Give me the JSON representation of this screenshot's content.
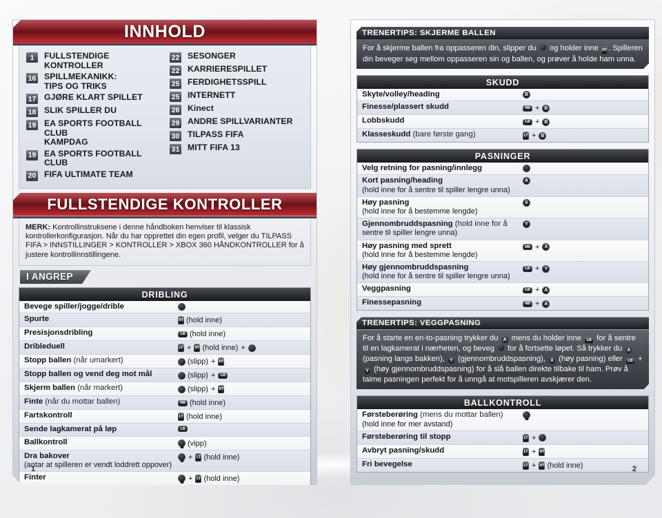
{
  "pages": {
    "left_number": "1",
    "right_number": "2"
  },
  "left": {
    "contents_banner": "INNHOLD",
    "toc": {
      "col1": [
        {
          "page": "1",
          "label": "FULLSTENDIGE KONTROLLER"
        },
        {
          "page": "16",
          "label": "SPILLMEKANIKK:\nTIPS OG TRIKS"
        },
        {
          "page": "17",
          "label": "GJØRE KLART SPILLET"
        },
        {
          "page": "18",
          "label": "SLIK SPILLER DU"
        },
        {
          "page": "19",
          "label": "EA SPORTS FOOTBALL CLUB\nKAMPDAG"
        },
        {
          "page": "19",
          "label": "EA SPORTS FOOTBALL CLUB"
        },
        {
          "page": "20",
          "label": "FIFA ULTIMATE TEAM"
        }
      ],
      "col2": [
        {
          "page": "22",
          "label": "SESONGER"
        },
        {
          "page": "22",
          "label": "KARRIERESPILLET"
        },
        {
          "page": "25",
          "label": "FERDIGHETSSPILL"
        },
        {
          "page": "25",
          "label": "INTERNETT"
        },
        {
          "page": "26",
          "label": "Kinect"
        },
        {
          "page": "29",
          "label": "ANDRE SPILLVARIANTER"
        },
        {
          "page": "30",
          "label": "TILPASS FIFA"
        },
        {
          "page": "31",
          "label": "MITT FIFA 13"
        }
      ]
    },
    "controls_banner": "FULLSTENDIGE KONTROLLER",
    "note": {
      "label": "MERK:",
      "text": " Kontrollinstruksene i denne håndboken henviser til klassisk kontrollerkonfigurasjon. Når du har opprettet din egen profil, velger du TILPASS FIFA > INNSTILLINGER > KONTROLLER > XBOX 360 HÅNDKONTROLLER for å justere kontrollinnstillingene."
    },
    "tab": "I ANGREP",
    "dribling": {
      "header": "DRIBLING",
      "rows": [
        {
          "name": "Bevege spiller/jogge/drible",
          "sub": "",
          "line2": "",
          "combo": [
            {
              "t": "stick",
              "k": "LS"
            }
          ]
        },
        {
          "name": "Spurte",
          "sub": "",
          "line2": "",
          "combo": [
            {
              "t": "trig",
              "k": "RT"
            },
            {
              "t": "txt",
              "k": "(hold inne)"
            }
          ]
        },
        {
          "name": "Presisjonsdribling",
          "sub": "",
          "line2": "",
          "combo": [
            {
              "t": "bump",
              "k": "LB"
            },
            {
              "t": "txt",
              "k": "(hold inne)"
            }
          ]
        },
        {
          "name": "Dribleduell",
          "sub": "",
          "line2": "",
          "combo": [
            {
              "t": "trig",
              "k": "LT"
            },
            {
              "t": "plus",
              "k": "+"
            },
            {
              "t": "trig",
              "k": "RT"
            },
            {
              "t": "txt",
              "k": "(hold inne)"
            },
            {
              "t": "plus",
              "k": "+"
            },
            {
              "t": "stick",
              "k": "LS"
            }
          ]
        },
        {
          "name": "Stopp ballen",
          "sub": " (når umarkert)",
          "line2": "",
          "combo": [
            {
              "t": "stick",
              "k": "LS"
            },
            {
              "t": "txt",
              "k": "(slipp)"
            },
            {
              "t": "plus",
              "k": "+"
            },
            {
              "t": "trig",
              "k": "RT"
            }
          ]
        },
        {
          "name": "Stopp ballen og vend deg mot mål",
          "sub": "",
          "line2": "",
          "combo": [
            {
              "t": "stick",
              "k": "LS"
            },
            {
              "t": "txt",
              "k": "(slipp)"
            },
            {
              "t": "plus",
              "k": "+"
            },
            {
              "t": "bump",
              "k": "LB"
            }
          ]
        },
        {
          "name": "Skjerm ballen",
          "sub": " (når markert)",
          "line2": "",
          "combo": [
            {
              "t": "stick",
              "k": "LS"
            },
            {
              "t": "txt",
              "k": "(slipp)"
            },
            {
              "t": "plus",
              "k": "+"
            },
            {
              "t": "trig",
              "k": "RT"
            }
          ]
        },
        {
          "name": "Finte",
          "sub": " (når du mottar ballen)",
          "line2": "",
          "combo": [
            {
              "t": "bump",
              "k": "RB"
            },
            {
              "t": "txt",
              "k": "(hold inne)"
            }
          ]
        },
        {
          "name": "Fartskontroll",
          "sub": "",
          "line2": "",
          "combo": [
            {
              "t": "trig",
              "k": "LT"
            },
            {
              "t": "txt",
              "k": "(hold inne)"
            }
          ]
        },
        {
          "name": "Sende lagkamerat på løp",
          "sub": "",
          "line2": "",
          "combo": [
            {
              "t": "bump",
              "k": "LB"
            }
          ]
        },
        {
          "name": "Ballkontroll",
          "sub": "",
          "line2": "",
          "combo": [
            {
              "t": "rstick",
              "k": "RS"
            },
            {
              "t": "txt",
              "k": "(vipp)"
            }
          ]
        },
        {
          "name": "Dra bakover",
          "sub": "",
          "line2": "(antar at spilleren er vendt loddrett oppover)",
          "combo": [
            {
              "t": "rstick",
              "k": "RS"
            },
            {
              "t": "plus",
              "k": "+"
            },
            {
              "t": "trig",
              "k": "LT"
            },
            {
              "t": "txt",
              "k": "(hold inne)"
            }
          ]
        },
        {
          "name": "Finter",
          "sub": "",
          "line2": "",
          "combo": [
            {
              "t": "rstick",
              "k": "RS"
            },
            {
              "t": "plus",
              "k": "+"
            },
            {
              "t": "trig",
              "k": "LT"
            },
            {
              "t": "txt",
              "k": "(hold inne)"
            }
          ]
        }
      ]
    }
  },
  "right": {
    "tip_skjerme": {
      "header": "TRENERTIPS: SKJERME BALLEN",
      "parts": [
        {
          "t": "txt",
          "k": "For å skjerme ballen fra oppasseren din, slipper du "
        },
        {
          "t": "stick",
          "k": "LS"
        },
        {
          "t": "txt",
          "k": " og holder inne "
        },
        {
          "t": "trig",
          "k": "RT"
        },
        {
          "t": "txt",
          "k": ". Spilleren din beveger seg mellom oppasseren sin og ballen, og prøver å holde ham unna."
        }
      ]
    },
    "skudd": {
      "header": "SKUDD",
      "rows": [
        {
          "name": "Skyte/volley/heading",
          "sub": "",
          "line2": "",
          "combo": [
            {
              "t": "round",
              "k": "B"
            }
          ]
        },
        {
          "name": "Finesse/plassert skudd",
          "sub": "",
          "line2": "",
          "combo": [
            {
              "t": "bump",
              "k": "RB"
            },
            {
              "t": "plus",
              "k": "+"
            },
            {
              "t": "round",
              "k": "B"
            }
          ]
        },
        {
          "name": "Lobbskudd",
          "sub": "",
          "line2": "",
          "combo": [
            {
              "t": "bump",
              "k": "LB"
            },
            {
              "t": "plus",
              "k": "+"
            },
            {
              "t": "round",
              "k": "B"
            }
          ]
        },
        {
          "name": "Klasseskudd",
          "sub": " (bare første gang)",
          "line2": "",
          "combo": [
            {
              "t": "trig",
              "k": "LT"
            },
            {
              "t": "plus",
              "k": "+"
            },
            {
              "t": "round",
              "k": "B"
            }
          ]
        }
      ]
    },
    "pasninger": {
      "header": "PASNINGER",
      "rows": [
        {
          "name": "Velg retning for pasning/innlegg",
          "sub": "",
          "line2": "",
          "combo": [
            {
              "t": "stick",
              "k": "LS"
            }
          ]
        },
        {
          "name": "Kort pasning/heading",
          "sub": "",
          "line2": "(hold inne for å sentre til spiller lengre unna)",
          "combo": [
            {
              "t": "round",
              "k": "A"
            }
          ]
        },
        {
          "name": "Høy pasning",
          "sub": "",
          "line2": "(hold inne for å bestemme lengde)",
          "combo": [
            {
              "t": "round",
              "k": "X"
            }
          ]
        },
        {
          "name": "Gjennombruddspasning",
          "sub": " (hold inne for å",
          "line2": "sentre til spiller lengre unna)",
          "combo": [
            {
              "t": "round",
              "k": "Y"
            }
          ]
        },
        {
          "name": "Høy pasning med sprett",
          "sub": "",
          "line2": "(hold inne for å bestemme lengde)",
          "combo": [
            {
              "t": "bump",
              "k": "RB"
            },
            {
              "t": "plus",
              "k": "+"
            },
            {
              "t": "round",
              "k": "X"
            }
          ]
        },
        {
          "name": "Høy gjennombruddspasning",
          "sub": "",
          "line2": "(hold inne for å sentre til spiller lengre unna)",
          "combo": [
            {
              "t": "bump",
              "k": "LB"
            },
            {
              "t": "plus",
              "k": "+"
            },
            {
              "t": "round",
              "k": "Y"
            }
          ]
        },
        {
          "name": "Veggpasning",
          "sub": "",
          "line2": "",
          "combo": [
            {
              "t": "bump",
              "k": "LB"
            },
            {
              "t": "plus",
              "k": "+"
            },
            {
              "t": "round",
              "k": "A"
            }
          ]
        },
        {
          "name": "Finessepasning",
          "sub": "",
          "line2": "",
          "combo": [
            {
              "t": "bump",
              "k": "RB"
            },
            {
              "t": "plus",
              "k": "+"
            },
            {
              "t": "round",
              "k": "A"
            }
          ]
        }
      ]
    },
    "tip_veggpasning": {
      "header": "TRENERTIPS: VEGGPASNING",
      "parts": [
        {
          "t": "txt",
          "k": "For å starte en en-to-pasning trykker du "
        },
        {
          "t": "round",
          "k": "A"
        },
        {
          "t": "txt",
          "k": " mens du holder inne "
        },
        {
          "t": "bump",
          "k": "LB"
        },
        {
          "t": "txt",
          "k": " for å sentre til en lagkamerat i nærheten, og beveg "
        },
        {
          "t": "stick",
          "k": "LS"
        },
        {
          "t": "txt",
          "k": " for å fortsette løpet. Så trykker du "
        },
        {
          "t": "round",
          "k": "A"
        },
        {
          "t": "txt",
          "k": " (pasning langs bakken), "
        },
        {
          "t": "round",
          "k": "Y"
        },
        {
          "t": "txt",
          "k": " (gjennombruddspasning), "
        },
        {
          "t": "round",
          "k": "X"
        },
        {
          "t": "txt",
          "k": " (høy pasning) eller "
        },
        {
          "t": "bump",
          "k": "LB"
        },
        {
          "t": "txt",
          "k": " + "
        },
        {
          "t": "round",
          "k": "Y"
        },
        {
          "t": "txt",
          "k": " (høy gjennombruddspasning) for å slå ballen direkte tilbake til ham. Prøv å taime pasningen perfekt for å unngå at motspilleren avskjærer den."
        }
      ]
    },
    "ballkontroll": {
      "header": "BALLKONTROLL",
      "rows": [
        {
          "name": "Førsteberøring",
          "sub": " (mens du mottar ballen)",
          "line2": "(hold inne for mer avstand)",
          "combo": [
            {
              "t": "rstick",
              "k": "RS"
            }
          ]
        },
        {
          "name": "Førsteberøring til stopp",
          "sub": "",
          "line2": "",
          "combo": [
            {
              "t": "trig",
              "k": "LT"
            },
            {
              "t": "plus",
              "k": "+"
            },
            {
              "t": "stick",
              "k": "LS"
            }
          ]
        },
        {
          "name": "Avbryt pasning/skudd",
          "sub": "",
          "line2": "",
          "combo": [
            {
              "t": "trig",
              "k": "LT"
            },
            {
              "t": "plus",
              "k": "+"
            },
            {
              "t": "trig",
              "k": "RT"
            }
          ]
        },
        {
          "name": "Fri bevegelse",
          "sub": "",
          "line2": "",
          "combo": [
            {
              "t": "trig",
              "k": "LT"
            },
            {
              "t": "plus",
              "k": "+"
            },
            {
              "t": "trig",
              "k": "RT"
            },
            {
              "t": "txt",
              "k": "(hold inne)"
            }
          ]
        }
      ]
    }
  },
  "colors": {
    "banner_red": "#8e1b21",
    "header_dark": "#26292e",
    "tab_gray": "#55585f"
  }
}
